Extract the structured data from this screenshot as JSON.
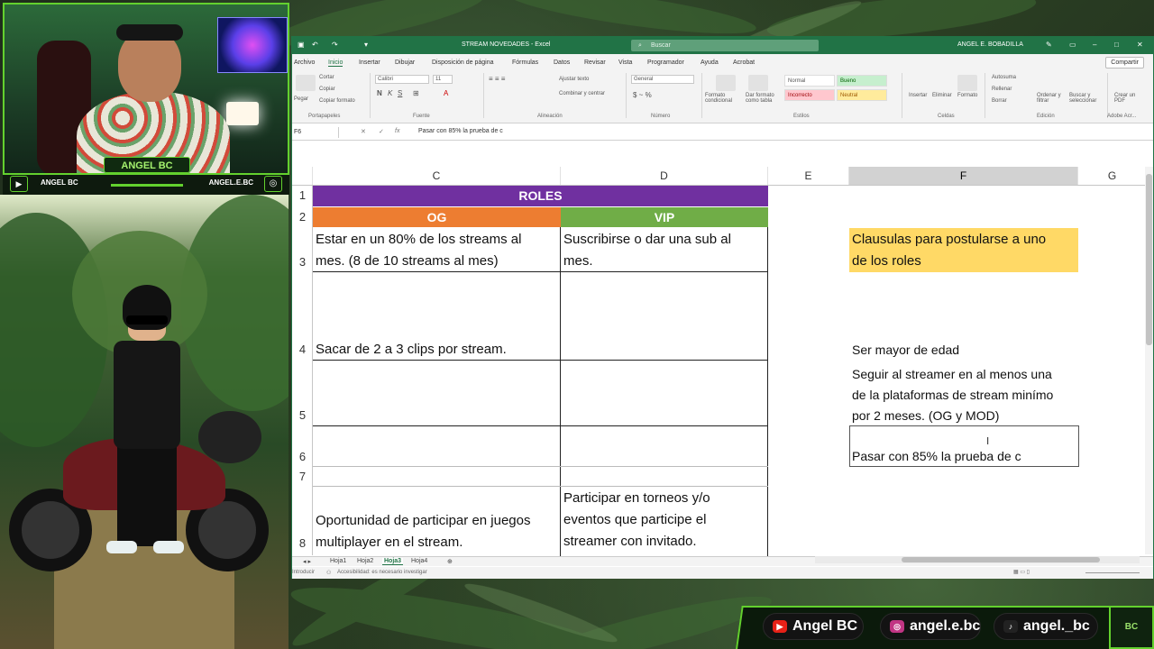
{
  "webcam": {
    "title": "ANGEL BC",
    "left_handle": "ANGEL BC",
    "right_handle": "ANGEL.E.BC"
  },
  "window": {
    "title": "STREAM NOVEDADES  -  Excel",
    "search_placeholder": "Buscar",
    "user": "ANGEL E. BOBADILLA",
    "tabs": [
      "Archivo",
      "Inicio",
      "Insertar",
      "Dibujar",
      "Disposición de página",
      "Fórmulas",
      "Datos",
      "Revisar",
      "Vista",
      "Programador",
      "Ayuda",
      "Acrobat"
    ],
    "active_tab": "Inicio",
    "share": "Compartir"
  },
  "ribbon": {
    "clipboard": {
      "paste": "Pegar",
      "cut": "Cortar",
      "copy": "Copiar",
      "format_painter": "Copiar formato",
      "group": "Portapapeles"
    },
    "font": {
      "name": "Calibri",
      "size": "11",
      "group": "Fuente",
      "bold": "N",
      "italic": "K",
      "underline": "S"
    },
    "alignment": {
      "wrap": "Ajustar texto",
      "merge": "Combinar y centrar",
      "group": "Alineación"
    },
    "number": {
      "format": "General",
      "group": "Número"
    },
    "styles": {
      "conditional": "Formato condicional",
      "as_table": "Dar formato como tabla",
      "normal": "Normal",
      "good": "Bueno",
      "bad": "Incorrecto",
      "neutral": "Neutral",
      "group": "Estilos"
    },
    "cells": {
      "insert": "Insertar",
      "delete": "Eliminar",
      "format": "Formato",
      "group": "Celdas"
    },
    "editing": {
      "autosum": "Autosuma",
      "fill": "Rellenar",
      "clear": "Borrar",
      "sort": "Ordenar y filtrar",
      "find": "Buscar y seleccionar",
      "group": "Edición"
    },
    "adobe": {
      "create_pdf": "Crear un PDF",
      "group": "Adobe Acr..."
    }
  },
  "formula_bar": {
    "name_box": "F6",
    "content": "Pasar con 85% la prueba de c"
  },
  "columns": [
    "C",
    "D",
    "E",
    "F",
    "G"
  ],
  "selected_column": "F",
  "rows": [
    "1",
    "2",
    "3",
    "4",
    "5",
    "6",
    "7",
    "8"
  ],
  "sheet": {
    "roles_title": "ROLES",
    "og_header": "OG",
    "vip_header": "VIP",
    "c3_line1": "Estar en un 80% de los streams al",
    "c3_line2": "mes. (8 de 10 streams al mes)",
    "d3_line1": "Suscribirse o dar una sub al",
    "d3_line2": "mes.",
    "c4": "Sacar de 2 a 3 clips por stream.",
    "d8_line1": "Participar en torneos y/o",
    "d8_line2": "eventos que participe el",
    "d8_line3": "streamer con invitado.",
    "c8_line1": "Oportunidad de participar en juegos",
    "c8_line2": "multiplayer en el stream.",
    "f3_line1": "Clausulas para postularse a uno",
    "f3_line2": "de los roles",
    "f4": "Ser mayor de edad",
    "f5_line1": "Seguir al streamer en al menos una",
    "f5_line2": "de la plataformas de stream minímo",
    "f5_line3": "por 2 meses. (OG y MOD)",
    "f6": "Pasar con 85% la prueba de c"
  },
  "sheet_tabs": [
    "Hoja1",
    "Hoja2",
    "Hoja3",
    "Hoja4"
  ],
  "active_sheet": "Hoja3",
  "status": {
    "mode": "Introducir",
    "accessibility": "Accesibilidad: es necesario investigar"
  },
  "social": {
    "youtube": "Angel BC",
    "instagram": "angel.e.bc",
    "tiktok": "angel._bc",
    "logo": "BC"
  },
  "colors": {
    "purple": "#7030a0",
    "orange": "#ed7d31",
    "green": "#70ad47",
    "yellow": "#ffd966",
    "excel_green": "#217346",
    "stream_green": "#63d12e"
  }
}
